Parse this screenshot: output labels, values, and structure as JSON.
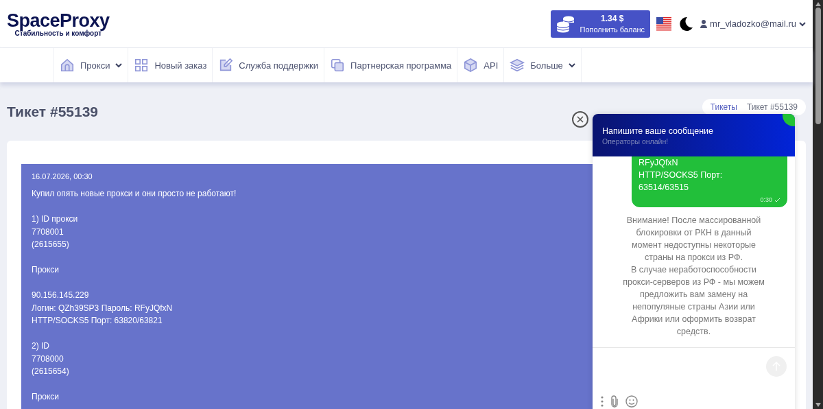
{
  "header": {
    "logo": "SpaceProxy",
    "tagline": "Стабильность и комфорт",
    "balance": {
      "amount": "1.34 $",
      "action": "Пополнить баланс"
    },
    "user": "mr_vladozko@mail.ru"
  },
  "nav": [
    {
      "kind": "home",
      "label": "Прокси",
      "dropdown": true
    },
    {
      "kind": "grid",
      "label": "Новый заказ",
      "dropdown": false
    },
    {
      "kind": "edit",
      "label": "Служба поддержки",
      "dropdown": false
    },
    {
      "kind": "copy",
      "label": "Партнерская программа",
      "dropdown": false
    },
    {
      "kind": "cube",
      "label": "API",
      "dropdown": false
    },
    {
      "kind": "layers",
      "label": "Больше",
      "dropdown": true
    }
  ],
  "page": {
    "title": "Тикет #55139",
    "breadcrumbs": [
      "Тикеты",
      "Тикет #55139"
    ]
  },
  "message": {
    "time": "16.07.2026, 00:30",
    "blocks": [
      [
        "Купил опять новые прокси и они просто не работают!"
      ],
      [
        "1) ID прокси",
        "7708001",
        "(2615655)"
      ],
      [
        "Прокси"
      ],
      [
        "90.156.145.229",
        "Логин: QZh39SP3 Пароль: RFyJQfxN",
        "HTTP/SOCKS5 Порт: 63820/63821"
      ],
      [
        "2) ID",
        "7708000",
        "(2615654)"
      ],
      [
        "Прокси"
      ]
    ]
  },
  "chat": {
    "title": "Напишите ваше сообщение",
    "status": "Операторы онлайн!",
    "bubble": {
      "lines": [
        "RFyJQfxN",
        "HTTP/SOCKS5 Порт:",
        "63514/63515"
      ],
      "time": "0:30",
      "read": true
    },
    "notice": "Внимание! После массированной блокировки от РКН в данный момент недоступны некоторые страны на прокси из РФ.\nВ случае неработоспособности прокси-серверов из РФ - мы можем предложить вам замену на непопуляные страны Азии или Африки или оформить возврат средств."
  }
}
